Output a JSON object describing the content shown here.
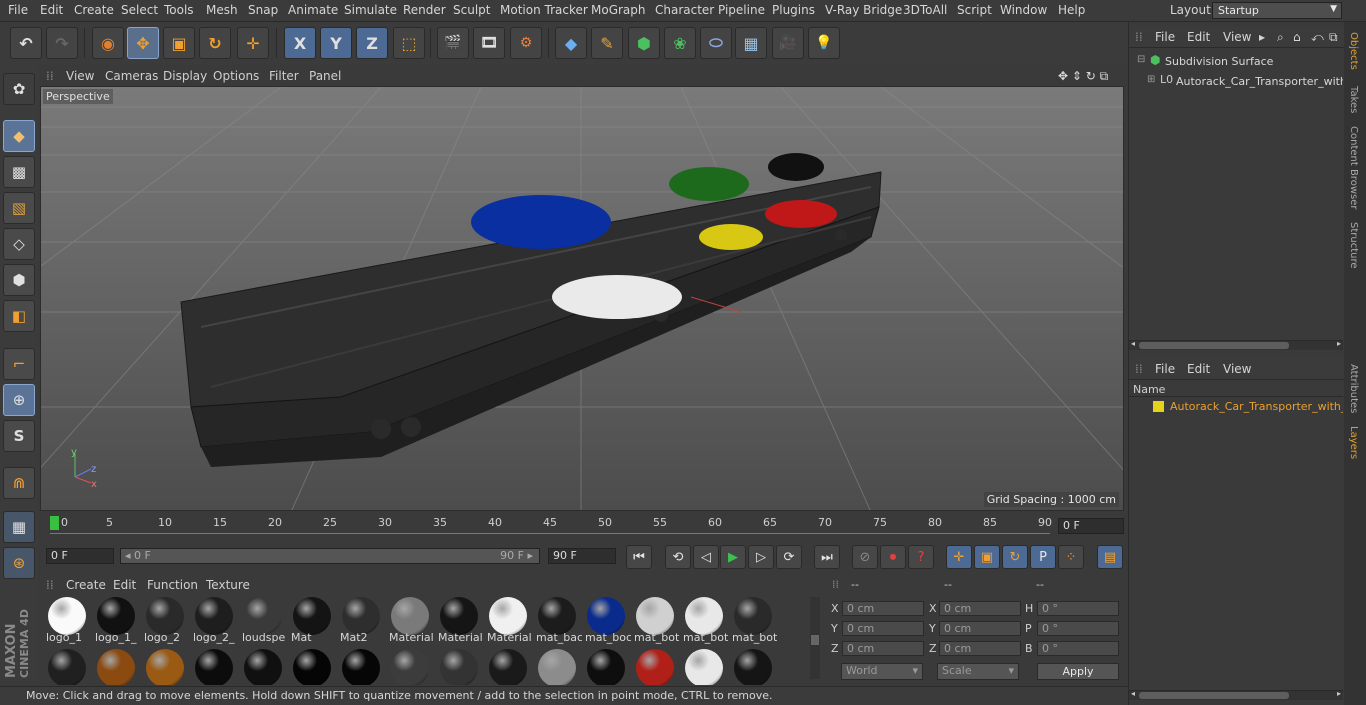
{
  "menubar": {
    "items": [
      "File",
      "Edit",
      "Create",
      "Select",
      "Tools",
      "Mesh",
      "Snap",
      "Animate",
      "Simulate",
      "Render",
      "Sculpt",
      "Motion Tracker",
      "MoGraph",
      "Character",
      "Pipeline",
      "Plugins",
      "V-Ray Bridge",
      "3DToAll",
      "Script",
      "Window",
      "Help"
    ],
    "layout_label": "Layout:",
    "layout_value": "Startup"
  },
  "toolbar": {
    "undo": "↶",
    "redo": "↷",
    "live_select": "◉",
    "move": "✥",
    "scale": "▣",
    "rotate": "↻",
    "transform": "✛",
    "axis_x": "X",
    "axis_y": "Y",
    "axis_z": "Z",
    "world": "⬚",
    "render_view": "🎬",
    "render_pic": "🎞",
    "render_settings": "⚙",
    "cube": "◆",
    "pen": "✎",
    "subdiv": "⬢",
    "cloner": "❀",
    "deformer": "⬭",
    "floor": "▦",
    "camera": "🎥",
    "light": "💡"
  },
  "leftbar": {
    "tools": [
      "◆",
      "▩",
      "▧",
      "◇",
      "⬢",
      "◧",
      "⌐",
      "⊕",
      "S",
      "⋒"
    ]
  },
  "maxon": {
    "line1": "MAXON",
    "line2": "CINEMA 4D"
  },
  "viewport": {
    "menu": [
      "View",
      "Cameras",
      "Display",
      "Options",
      "Filter",
      "Panel"
    ],
    "label": "Perspective",
    "grid_spacing": "Grid Spacing : 1000 cm",
    "nav_icons": "✥ ⇕ ↻ ⧉"
  },
  "timeline": {
    "ticks": [
      "0",
      "5",
      "10",
      "15",
      "20",
      "25",
      "30",
      "35",
      "40",
      "45",
      "50",
      "55",
      "60",
      "65",
      "70",
      "75",
      "80",
      "85",
      "90"
    ],
    "end_field": "0 F"
  },
  "transport": {
    "start": "0 F",
    "range_start": "◂ 0 F",
    "range_end": "90 F ▸",
    "end": "90 F",
    "buttons": [
      "⏮",
      "⟲",
      "◁",
      "▶",
      "▷",
      "⟳",
      "⏭"
    ],
    "record": [
      "⊘",
      "⏺",
      "?"
    ],
    "modes": [
      "✛",
      "▣",
      "↻",
      "P",
      "⁘"
    ],
    "film": "▤"
  },
  "matmgr": {
    "menu": [
      "Create",
      "Edit",
      "Function",
      "Texture"
    ]
  },
  "materials": {
    "row1": [
      {
        "label": "logo_1",
        "color": "#fafafa"
      },
      {
        "label": "logo_1_",
        "color": "#111111"
      },
      {
        "label": "logo_2",
        "color": "#2a2a2a"
      },
      {
        "label": "logo_2_",
        "color": "#1e1e1e"
      },
      {
        "label": "loudspe",
        "color": "#3a3a3a"
      },
      {
        "label": "Mat",
        "color": "#141414"
      },
      {
        "label": "Mat2",
        "color": "#2e2e2e"
      },
      {
        "label": "Material",
        "color": "#7a7a7a"
      },
      {
        "label": "Material",
        "color": "#151515"
      },
      {
        "label": "Material",
        "color": "#f0f0f0"
      },
      {
        "label": "mat_bac",
        "color": "#1c1c1c"
      },
      {
        "label": "mat_boc",
        "color": "#0a2a8c"
      },
      {
        "label": "mat_bot",
        "color": "#d0d0d0"
      },
      {
        "label": "mat_bot",
        "color": "#e8e8e8"
      },
      {
        "label": "mat_bot",
        "color": "#2a2a2a"
      }
    ],
    "row2": [
      "#202020",
      "#8a4a10",
      "#9a5a14",
      "#0c0c0c",
      "#101010",
      "#050505",
      "#060606",
      "#3c3c3c",
      "#333333",
      "#1a1a1a",
      "#8c8c8c",
      "#0e0e0e",
      "#b02018",
      "#e8e8e8",
      "#151515"
    ]
  },
  "coords": {
    "headers": [
      "--",
      "--",
      "--"
    ],
    "rows": [
      {
        "a": "X",
        "av": "0 cm",
        "b": "X",
        "bv": "0 cm",
        "c": "H",
        "cv": "0 °"
      },
      {
        "a": "Y",
        "av": "0 cm",
        "b": "Y",
        "bv": "0 cm",
        "c": "P",
        "cv": "0 °"
      },
      {
        "a": "Z",
        "av": "0 cm",
        "b": "Z",
        "bv": "0 cm",
        "c": "B",
        "cv": "0 °"
      }
    ],
    "world": "World",
    "scale": "Scale",
    "apply": "Apply"
  },
  "status": "Move: Click and drag to move elements. Hold down SHIFT to quantize movement / add to the selection in point mode, CTRL to remove.",
  "objects": {
    "menu": [
      "File",
      "Edit",
      "View"
    ],
    "items": [
      "Subdivision Surface",
      "Autorack_Car_Transporter_with_"
    ]
  },
  "layers": {
    "menu": [
      "File",
      "Edit",
      "View"
    ],
    "header": "Name",
    "items": [
      "Autorack_Car_Transporter_with_C"
    ]
  },
  "sidetabs": [
    "Objects",
    "Takes",
    "Content Browser",
    "Structure",
    "Attributes",
    "Layers"
  ]
}
